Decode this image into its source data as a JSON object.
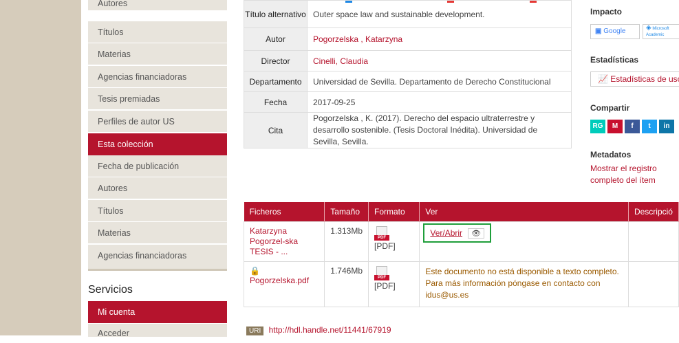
{
  "sidebar": {
    "items": [
      {
        "label": "Autores",
        "active": false
      },
      {
        "label": "Títulos",
        "active": false
      },
      {
        "label": "Materias",
        "active": false
      },
      {
        "label": "Agencias financiadoras",
        "active": false
      },
      {
        "label": "Tesis premiadas",
        "active": false
      },
      {
        "label": "Perfiles de autor US",
        "active": false
      },
      {
        "label": "Esta colección",
        "active": true
      },
      {
        "label": "Fecha de publicación",
        "active": false
      },
      {
        "label": "Autores",
        "active": false
      },
      {
        "label": "Títulos",
        "active": false
      },
      {
        "label": "Materias",
        "active": false
      },
      {
        "label": "Agencias financiadoras",
        "active": false
      }
    ],
    "services_heading": "Servicios",
    "service_items": [
      {
        "label": "Mi cuenta",
        "active": true
      },
      {
        "label": "Acceder",
        "active": false
      }
    ]
  },
  "metadata": {
    "rows": [
      {
        "key": "Título alternativo",
        "value": "Outer space law and sustainable development.",
        "link": false
      },
      {
        "key": "Autor",
        "value": "Pogorzelska , Katarzyna",
        "link": true
      },
      {
        "key": "Director",
        "value": "Cinelli, Claudia",
        "link": true
      },
      {
        "key": "Departamento",
        "value": "Universidad de Sevilla. Departamento de Derecho Constitucional",
        "link": false
      },
      {
        "key": "Fecha",
        "value": "2017-09-25",
        "link": false
      },
      {
        "key": "Cita",
        "value": "Pogorzelska , K. (2017). Derecho del espacio ultraterrestre y desarrollo sostenible. (Tesis Doctoral Inédita). Universidad de Sevilla, Sevilla.",
        "link": false
      }
    ]
  },
  "files": {
    "headers": {
      "ficheros": "Ficheros",
      "tamano": "Tamaño",
      "formato": "Formato",
      "ver": "Ver",
      "descripcion": "Descripció"
    },
    "rows": [
      {
        "name": "Katarzyna Pogorzel-ska TESIS - ...",
        "size": "1.313Mb",
        "format": "[PDF]",
        "ver": "Ver/Abrir"
      },
      {
        "name": "Pogorzelska.pdf",
        "size": "1.746Mb",
        "format": "[PDF]",
        "ver": "Este documento no está disponible a texto completo. Para más información póngase en contacto con idus@us.es"
      }
    ],
    "pdf_icon_text": "PDF"
  },
  "uri": {
    "badge": "URI",
    "link": "http://hdl.handle.net/11441/67919"
  },
  "right": {
    "impacto": "Impacto",
    "google_label": "Google",
    "academic_label": "Microsoft Academic",
    "estadisticas": "Estadísticas",
    "estadisticas_link": "Estadísticas de uso",
    "compartir": "Compartir",
    "share": [
      "RG",
      "M",
      "f",
      "t",
      "in"
    ],
    "metadatos": "Metadatos",
    "metadatos_link": "Mostrar el registro completo del ítem"
  },
  "colors": {
    "accent": "#b5142d",
    "sidebar_bg": "#e8e4dc",
    "highlight_box": "#1e9e3a"
  }
}
